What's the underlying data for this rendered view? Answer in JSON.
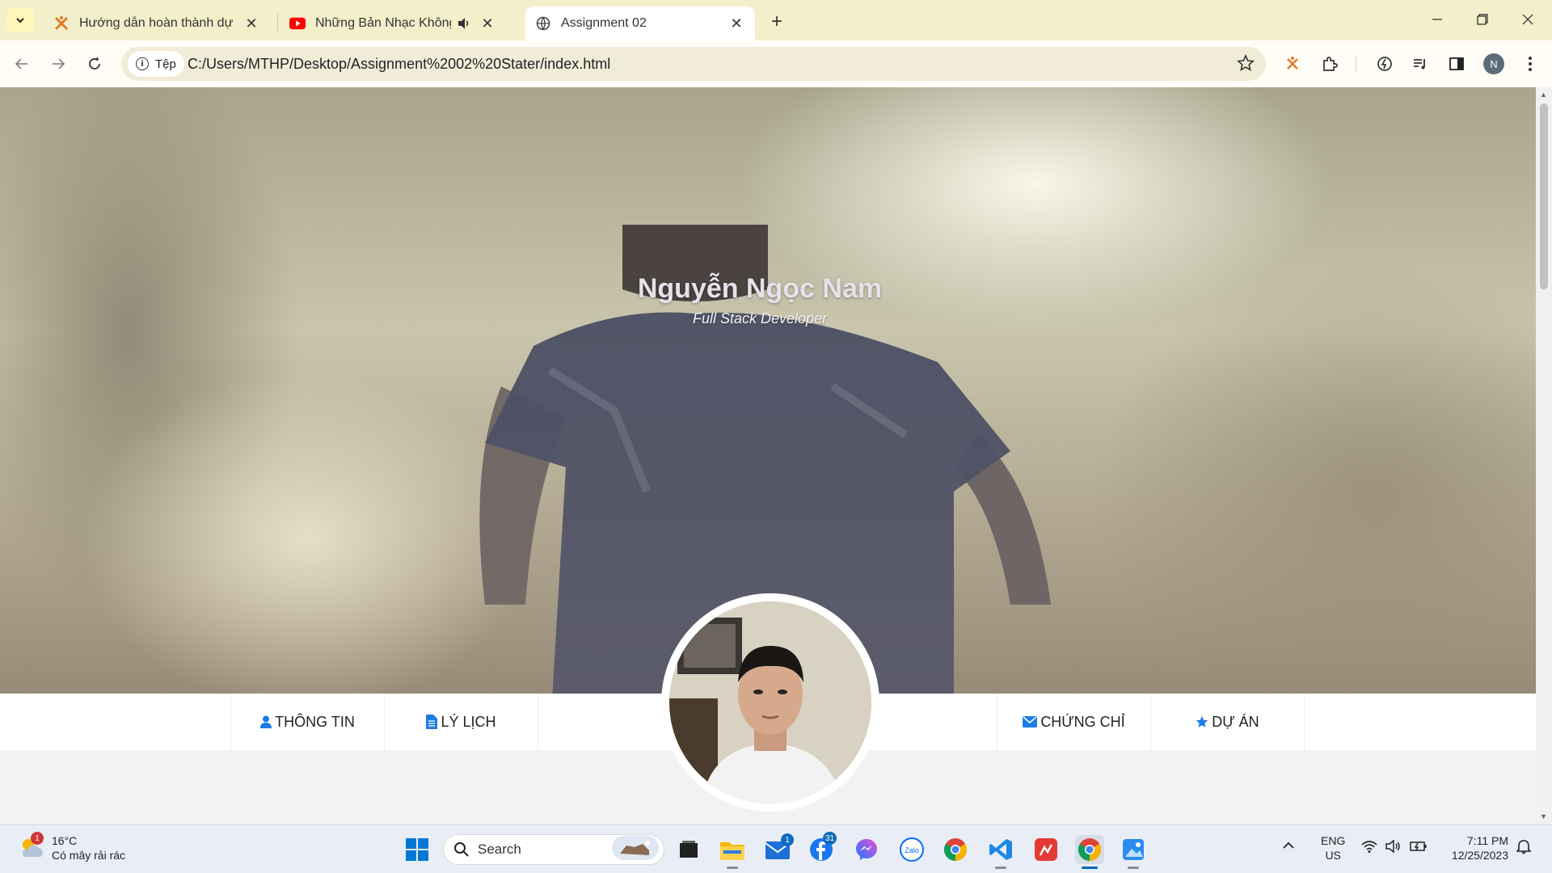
{
  "browser": {
    "tabs": [
      {
        "title": "Hướng dẫn hoàn thành dự án |",
        "close": "✕"
      },
      {
        "title": "Những Bản Nhạc Không Lời",
        "close": "✕"
      },
      {
        "title": "Assignment 02",
        "close": "✕"
      }
    ],
    "new_tab": "+",
    "site_chip": "Tệp",
    "url": "C:/Users/MTHP/Desktop/Assignment%2002%20Stater/index.html",
    "profile_initial": "N"
  },
  "page": {
    "hero_name": "Nguyễn Ngọc Nam",
    "hero_role": "Full Stack Developer",
    "nav": [
      {
        "label": "THÔNG TIN",
        "icon": "user-icon"
      },
      {
        "label": "LÝ LỊCH",
        "icon": "file-icon"
      },
      {
        "label": "CHỨNG CHỈ",
        "icon": "envelope-icon"
      },
      {
        "label": "DỰ ÁN",
        "icon": "star-icon"
      }
    ],
    "accent": "#1e7be6"
  },
  "taskbar": {
    "weather_badge": "1",
    "temp": "16°C",
    "condition": "Có mây rải rác",
    "search_label": "Search",
    "mail_badge": "1",
    "facebook_badge": "31",
    "lang_1": "ENG",
    "lang_2": "US",
    "time": "7:11 PM",
    "date": "12/25/2023"
  }
}
